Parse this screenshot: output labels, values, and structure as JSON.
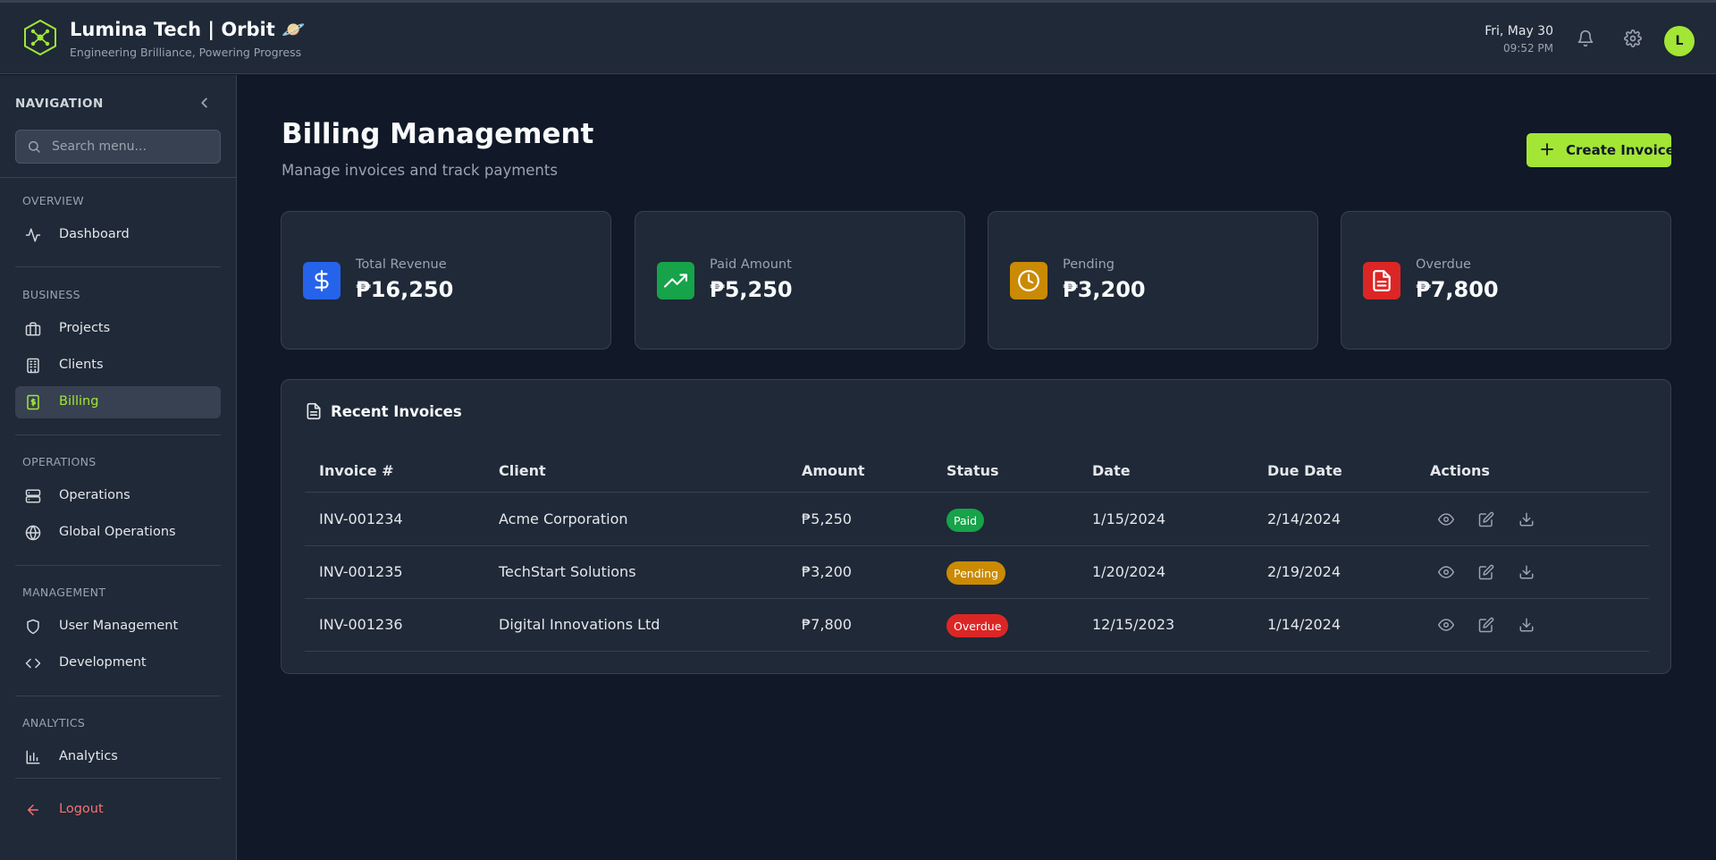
{
  "header": {
    "title": "Lumina Tech | Orbit 🪐",
    "subtitle": "Engineering Brilliance, Powering Progress",
    "date": "Fri, May 30",
    "time": "09:52 PM",
    "avatar_initial": "L",
    "icons": [
      "hex-logo-icon",
      "bell-icon",
      "gear-icon"
    ]
  },
  "sidebar": {
    "title": "NAVIGATION",
    "search_placeholder": "Search menu...",
    "sections": [
      {
        "label": "OVERVIEW",
        "items": [
          {
            "label": "Dashboard",
            "icon": "activity-icon"
          }
        ]
      },
      {
        "label": "BUSINESS",
        "items": [
          {
            "label": "Projects",
            "icon": "briefcase-icon"
          },
          {
            "label": "Clients",
            "icon": "building-icon"
          },
          {
            "label": "Billing",
            "icon": "receipt-icon",
            "active": true
          }
        ]
      },
      {
        "label": "OPERATIONS",
        "items": [
          {
            "label": "Operations",
            "icon": "server-icon"
          },
          {
            "label": "Global Operations",
            "icon": "globe-icon"
          }
        ]
      },
      {
        "label": "MANAGEMENT",
        "items": [
          {
            "label": "User Management",
            "icon": "shield-icon"
          },
          {
            "label": "Development",
            "icon": "code-icon"
          }
        ]
      },
      {
        "label": "ANALYTICS",
        "items": [
          {
            "label": "Analytics",
            "icon": "bar-chart-icon"
          }
        ]
      }
    ],
    "logout": "Logout"
  },
  "main": {
    "title": "Billing Management",
    "subtitle": "Manage invoices and track payments",
    "create_button": "Create Invoice",
    "stats": [
      {
        "label": "Total Revenue",
        "value": "₱16,250",
        "icon": "dollar-icon",
        "color": "#2563eb"
      },
      {
        "label": "Paid Amount",
        "value": "₱5,250",
        "icon": "trending-up-icon",
        "color": "#16a34a"
      },
      {
        "label": "Pending",
        "value": "₱3,200",
        "icon": "clock-icon",
        "color": "#ca8a04"
      },
      {
        "label": "Overdue",
        "value": "₱7,800",
        "icon": "file-icon",
        "color": "#dc2626"
      }
    ],
    "invoices": {
      "title": "Recent Invoices",
      "columns": [
        "Invoice #",
        "Client",
        "Amount",
        "Status",
        "Date",
        "Due Date",
        "Actions"
      ],
      "rows": [
        {
          "id": "INV-001234",
          "client": "Acme Corporation",
          "amount": "₱5,250",
          "status": "Paid",
          "date": "1/15/2024",
          "due": "2/14/2024"
        },
        {
          "id": "INV-001235",
          "client": "TechStart Solutions",
          "amount": "₱3,200",
          "status": "Pending",
          "date": "1/20/2024",
          "due": "2/19/2024"
        },
        {
          "id": "INV-001236",
          "client": "Digital Innovations Ltd",
          "amount": "₱7,800",
          "status": "Overdue",
          "date": "12/15/2023",
          "due": "1/14/2024"
        }
      ],
      "status_colors": {
        "Paid": "#16a34a",
        "Pending": "#ca8a04",
        "Overdue": "#dc2626"
      }
    }
  },
  "colors": {
    "accent": "#a3e635",
    "background": "#111827",
    "surface": "#1f2937",
    "danger": "#f87171"
  }
}
